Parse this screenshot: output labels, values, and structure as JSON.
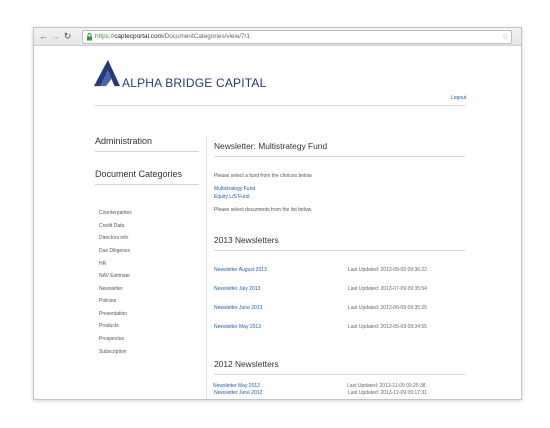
{
  "browser": {
    "url_scheme": "https://",
    "url_host": "captecportal.com",
    "url_path": "/DocumentCategories/view/7/1"
  },
  "brand": {
    "name": "ALPHA BRIDGE CAPITAL",
    "color": "#243b7a"
  },
  "header": {
    "logout": "Logout"
  },
  "sidebar": {
    "admin_title": "Administration",
    "doc_categories_title": "Document Categories",
    "items": [
      "Counterparties",
      "Credit Data",
      "Directors info",
      "Due Diligence",
      "HR",
      "NAV Estimate",
      "Newsletter",
      "Policies",
      "Presentation",
      "Products",
      "Prospectus",
      "Subscription"
    ]
  },
  "main": {
    "title": "Newsletter: Multistrategy Fund",
    "fund_prompt": "Please select a fund from the choices below",
    "funds": [
      "Multistrategy Fund",
      "Equity L/S Fund"
    ],
    "doc_prompt": "Please select documents from the list below.",
    "sections": [
      {
        "title": "2013 Newsletters",
        "rows": [
          {
            "name": "Newsletter August 2013",
            "updated": "Last Updated: 2013-08-09 09:36:22"
          },
          {
            "name": "Newsletter July 2013",
            "updated": "Last Updated: 2013-07-09 09:35:54"
          },
          {
            "name": "Newsletter June 2013",
            "updated": "Last Updated: 2013-06-09 09:35:25"
          },
          {
            "name": "Newsletter May 2013",
            "updated": "Last Updated: 2013-05-09 09:34:55"
          }
        ]
      },
      {
        "title": "2012 Newsletters",
        "rows": [
          {
            "name": "Newsletter June 2012",
            "updated": "Last Updated: 2013-12-09 09:17:31"
          },
          {
            "name": "Newsletter May 2012",
            "updated": "Last Updated: 2013-11-09 09:25:38"
          }
        ]
      }
    ]
  },
  "icons": {
    "back": "back-arrow-icon",
    "forward": "forward-arrow-icon",
    "reload": "reload-icon",
    "lock": "lock-icon",
    "bookmark": "star-icon"
  }
}
